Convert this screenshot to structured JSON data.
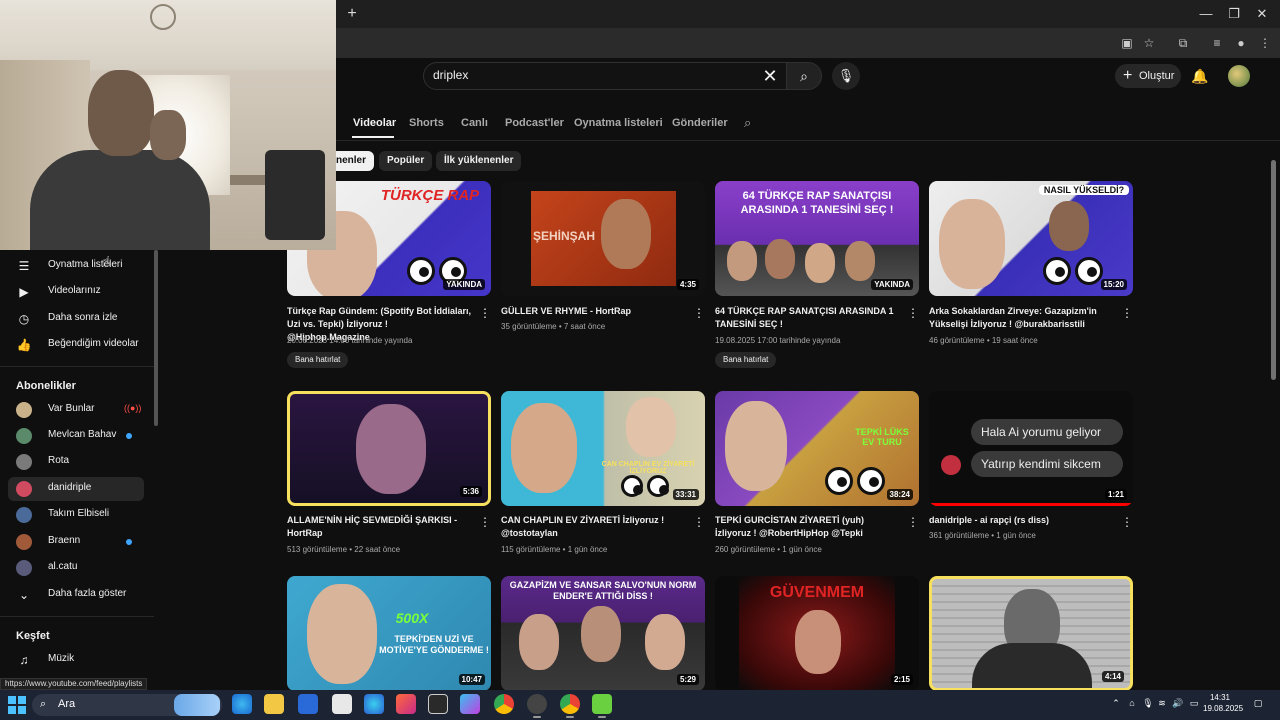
{
  "header": {
    "search_value": "driplex",
    "create_label": "Oluştur"
  },
  "tabs": [
    {
      "label": "Videolar",
      "active": true
    },
    {
      "label": "Shorts"
    },
    {
      "label": "Canlı"
    },
    {
      "label": "Podcast'ler"
    },
    {
      "label": "Oynatma listeleri"
    },
    {
      "label": "Gönderiler"
    }
  ],
  "chips": [
    {
      "label": "nenler",
      "selected": true
    },
    {
      "label": "Popüler"
    },
    {
      "label": "İlk yüklenenler"
    }
  ],
  "sidebar": {
    "you_items": [
      {
        "label": "Oynatma listeleri",
        "icon": "playlist-icon"
      },
      {
        "label": "Videolarınız",
        "icon": "video-icon"
      },
      {
        "label": "Daha sonra izle",
        "icon": "clock-icon"
      },
      {
        "label": "Beğendiğim videolar",
        "icon": "thumbs-up-icon"
      }
    ],
    "subscriptions_heading": "Abonelikler",
    "subscriptions": [
      {
        "label": "Var Bunlar",
        "color": "#c9b28a",
        "badge": "live"
      },
      {
        "label": "Mevlcan Bahav",
        "color": "#5a8a6a",
        "badge": "dot"
      },
      {
        "label": "Rota",
        "color": "#7a7a7a"
      },
      {
        "label": "danidriple",
        "color": "#d04a60",
        "active": true
      },
      {
        "label": "Takım Elbiseli",
        "color": "#4a6a9a"
      },
      {
        "label": "Braenn",
        "color": "#a05a3a",
        "badge": "dot"
      },
      {
        "label": "al.catu",
        "color": "#5a5a7a"
      }
    ],
    "show_more_label": "Daha fazla göster",
    "explore_heading": "Keşfet",
    "explore_items": [
      {
        "label": "Müzik",
        "icon": "music-icon"
      }
    ]
  },
  "videos": [
    {
      "title": "Türkçe Rap Gündem: (Spotify Bot İddiaları, Uzi vs. Tepki) İzliyoruz ! @Hiphop.Magazine",
      "meta": "20.08.2025 14:00 tarihinde yayında",
      "badge": "YAKINDA",
      "remind": "Bana hatırlat",
      "thumb_text": "TÜRKÇE RAP"
    },
    {
      "title": "GÜLLER VE RHYME - HortRap",
      "meta": "35 görüntüleme • 7 saat önce",
      "duration": "4:35",
      "thumb_text": "ŞEHİNŞAH"
    },
    {
      "title": "64 TÜRKÇE RAP SANATÇISI ARASINDA 1 TANESİNİ SEÇ !",
      "meta": "19.08.2025 17:00 tarihinde yayında",
      "badge": "YAKINDA",
      "remind": "Bana hatırlat",
      "thumb_text": "64 TÜRKÇE RAP SANATÇISI ARASINDA 1 TANESİNİ SEÇ !"
    },
    {
      "title": "Arka Sokaklardan Zirveye: Gazapizm'in Yükselişi İzliyoruz ! @burakbarisstili",
      "meta": "46 görüntüleme • 19 saat önce",
      "duration": "15:20",
      "thumb_text": "NASIL YÜKSELDİ?"
    },
    {
      "title": "ALLAME'NİN HİÇ SEVMEDİĞİ ŞARKISI - HortRap",
      "meta": "513 görüntüleme • 22 saat önce",
      "duration": "5:36"
    },
    {
      "title": "CAN CHAPLIN EV ZİYARETİ İzliyoruz ! @tostotaylan",
      "meta": "115 görüntüleme • 1 gün önce",
      "duration": "33:31",
      "thumb_text": "CAN CHAPLIN EV ZİYARETİ İZLİYORUZ"
    },
    {
      "title": "TEPKİ GURCİSTAN ZİYARETİ (yuh) İzliyoruz ! @RobertHipHop @Tepki",
      "meta": "260 görüntüleme • 1 gün önce",
      "duration": "38:24",
      "thumb_text": "TEPKİ LÜKS EV TURU"
    },
    {
      "title": "danidriple - ai rapçi (rs diss)",
      "meta": "361 görüntüleme • 1 gün önce",
      "duration": "1:21",
      "bubbles": [
        "Hala Ai yorumu geliyor",
        "Yatırıp kendimi sikcem"
      ]
    },
    {
      "duration": "10:47",
      "thumb_text": "TEPKİ'DEN UZİ VE MOTİVE'YE GÖNDERME !",
      "thumb_text2": "500X"
    },
    {
      "duration": "5:29",
      "thumb_text": "GAZAPİZM VE SANSAR SALVO'NUN NORM ENDER'E ATTIĞI DİSS !"
    },
    {
      "duration": "2:15",
      "thumb_text": "GÜVENMEM"
    },
    {
      "duration": "4:14"
    }
  ],
  "status_url": "https://www.youtube.com/feed/playlists",
  "taskbar": {
    "search_label": "Ara",
    "time": "14:31",
    "date": "19.08.2025"
  }
}
